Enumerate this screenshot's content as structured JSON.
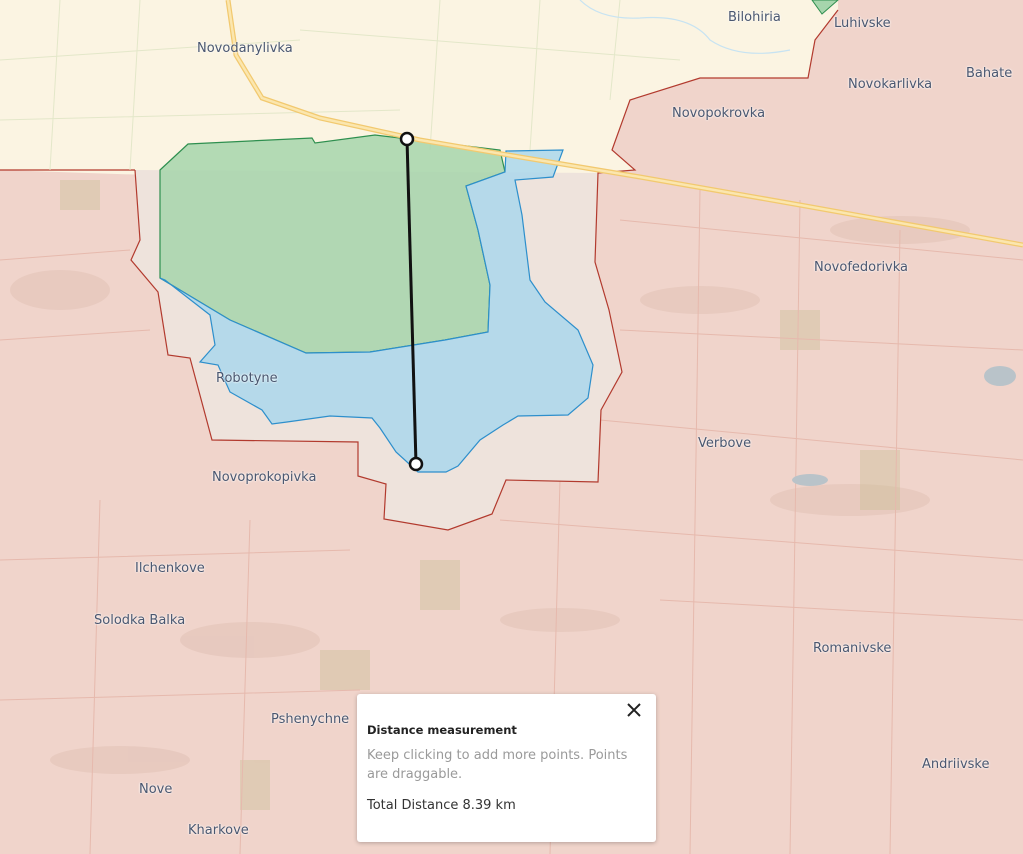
{
  "map": {
    "places": [
      {
        "id": "novodanylivka",
        "label": "Novodanylivka"
      },
      {
        "id": "bilohiria",
        "label": "Bilohiria"
      },
      {
        "id": "luhivske",
        "label": "Luhivske"
      },
      {
        "id": "novokarlivka",
        "label": "Novokarlivka"
      },
      {
        "id": "bahate",
        "label": "Bahate"
      },
      {
        "id": "novopokrovka",
        "label": "Novopokrovka"
      },
      {
        "id": "novofedorivka",
        "label": "Novofedorivka"
      },
      {
        "id": "robotyne",
        "label": "Robotyne"
      },
      {
        "id": "verbove",
        "label": "Verbove"
      },
      {
        "id": "novoprokopivka",
        "label": "Novoprokopivka"
      },
      {
        "id": "ilchenkove",
        "label": "Ilchenkove"
      },
      {
        "id": "solodka-balka",
        "label": "Solodka Balka"
      },
      {
        "id": "romanivske",
        "label": "Romanivske"
      },
      {
        "id": "pshenychne",
        "label": "Pshenychne"
      },
      {
        "id": "andriivske",
        "label": "Andriivske"
      },
      {
        "id": "nove",
        "label": "Nove"
      },
      {
        "id": "kharkove",
        "label": "Kharkove"
      }
    ],
    "colors": {
      "occupied_fill": "#f0d4cb",
      "occupied_border": "#b23a2e",
      "liberated_fill": "#fbf4e2",
      "contested_fill": "#eee3dc",
      "green_area": "#9fd3a6",
      "blue_area": "#a9d8ef",
      "road": "#f7d98a",
      "measure_line": "#111111"
    }
  },
  "popup": {
    "title": "Distance measurement",
    "hint": "Keep clicking to add more points. Points are draggable.",
    "total_label": "Total Distance",
    "total_value": "8.39 km",
    "close_icon": "close-icon"
  }
}
